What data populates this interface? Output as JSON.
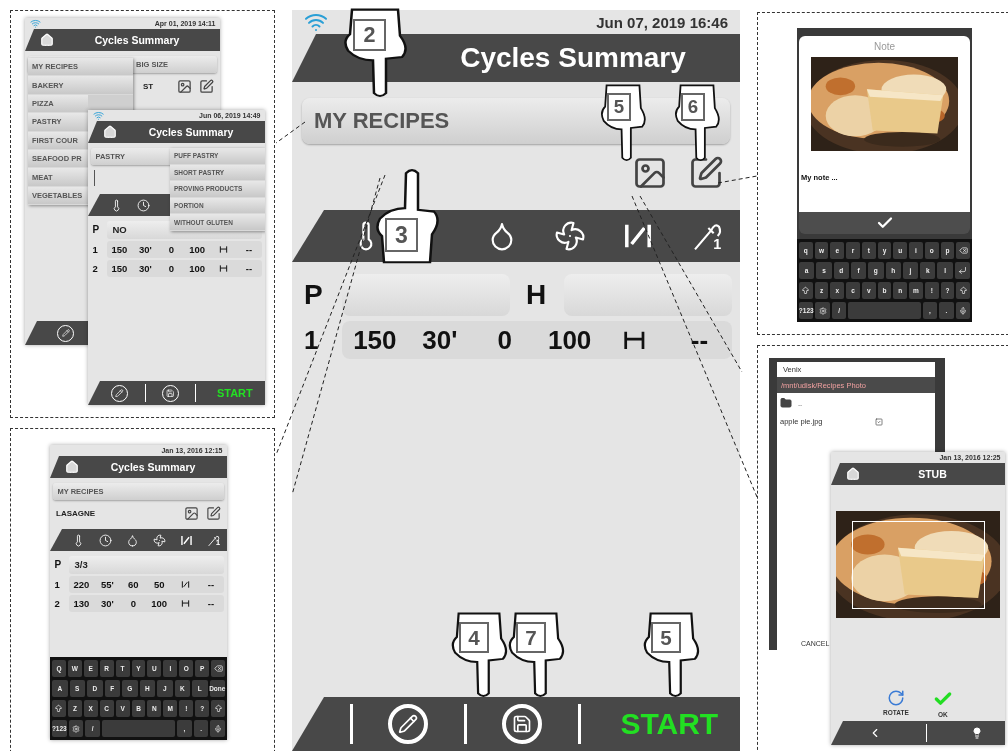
{
  "main_screen": {
    "date": "Jun 07, 2019  16:46",
    "title": "Cycles Summary",
    "category": "MY RECIPES",
    "icons": [
      {
        "kind": "thermometer"
      },
      {
        "kind": "drop"
      },
      {
        "kind": "fan"
      },
      {
        "kind": "valve"
      },
      {
        "kind": "probe",
        "label": "1"
      }
    ],
    "p_label": "P",
    "h_label": "H",
    "steps": [
      {
        "number": "1",
        "temp": "150",
        "time": "30'",
        "humidity": "0",
        "fan": "100",
        "valve_open": false,
        "probe": "--"
      }
    ],
    "action": "START"
  },
  "callouts": [
    {
      "number": "2",
      "points_up": false
    },
    {
      "number": "3",
      "points_up": true
    },
    {
      "number": "5",
      "points_up": false
    },
    {
      "number": "6",
      "points_up": false
    },
    {
      "number": "4",
      "points_up": false
    },
    {
      "number": "7",
      "points_up": false
    },
    {
      "number": "5",
      "points_up": false
    }
  ],
  "recipe_menu_screen": {
    "date": "Apr 01, 2019  14:11",
    "title": "Cycles Summary",
    "field": "BIG SIZE",
    "name": "ST",
    "menu": [
      "MY RECIPES",
      "BAKERY",
      "PIZZA",
      "PASTRY",
      "FIRST COUR",
      "SEAFOOD PR",
      "MEAT",
      "VEGETABLES"
    ]
  },
  "subcategory_screen": {
    "date": "Jun 06, 2019  14:49",
    "title": "Cycles Summary",
    "category": "PASTRY",
    "submenu": [
      "PUFF PASTRY",
      "SHORT PASTRY",
      "PROVING PRODUCTS",
      "PORTION",
      "WITHOUT GLUTEN"
    ],
    "icons": [
      {
        "kind": "thermometer"
      },
      {
        "kind": "clock"
      }
    ],
    "p_label": "P",
    "p_value": "NO",
    "steps": [
      {
        "number": "1",
        "temp": "150",
        "time": "30'",
        "humidity": "0",
        "fan": "100",
        "valve_open": false,
        "probe": "--"
      },
      {
        "number": "2",
        "temp": "150",
        "time": "30'",
        "humidity": "0",
        "fan": "100",
        "valve_open": false,
        "probe": "--"
      }
    ],
    "action": "START"
  },
  "name_screen": {
    "date": "Jan 13, 2016  12:15",
    "title": "Cycles Summary",
    "category": "MY RECIPES",
    "name": "LASAGNE",
    "icons": [
      {
        "kind": "thermometer"
      },
      {
        "kind": "clock"
      },
      {
        "kind": "drop"
      },
      {
        "kind": "fan"
      },
      {
        "kind": "valve"
      },
      {
        "kind": "probe",
        "label": "1"
      }
    ],
    "p_label": "P",
    "p_value": "3/3",
    "steps": [
      {
        "number": "1",
        "temp": "220",
        "time": "55'",
        "humidity": "60",
        "fan": "50",
        "valve_open": true,
        "probe": "--"
      },
      {
        "number": "2",
        "temp": "130",
        "time": "30'",
        "humidity": "0",
        "fan": "100",
        "valve_open": false,
        "probe": "--"
      }
    ],
    "keyboard": {
      "rows": [
        {
          "keys": [
            "Q",
            "W",
            "E",
            "R",
            "T",
            "Y",
            "U",
            "I",
            "O",
            "P",
            {
              "kind": "backspace"
            }
          ]
        },
        {
          "keys": [
            "A",
            "S",
            "D",
            "F",
            "G",
            "H",
            "J",
            "K",
            "L",
            "Done"
          ]
        },
        {
          "keys": [
            {
              "kind": "shift"
            },
            "Z",
            "X",
            "C",
            "V",
            "B",
            "N",
            "M",
            "!",
            "?",
            {
              "kind": "shift"
            }
          ]
        },
        {
          "keys": [
            "?123",
            {
              "kind": "gear"
            },
            "/",
            {
              "kind": "space"
            },
            ",",
            ".",
            {
              "kind": "mic"
            }
          ]
        }
      ]
    }
  },
  "note_dialog": {
    "title": "Note",
    "note": "My note ...",
    "keyboard": {
      "rows": [
        {
          "keys": [
            "q",
            "w",
            "e",
            "r",
            "t",
            "y",
            "u",
            "i",
            "o",
            "p",
            {
              "kind": "backspace"
            }
          ]
        },
        {
          "keys": [
            "a",
            "s",
            "d",
            "f",
            "g",
            "h",
            "j",
            "k",
            "l",
            {
              "kind": "enter"
            }
          ]
        },
        {
          "keys": [
            {
              "kind": "shift"
            },
            "z",
            "x",
            "c",
            "v",
            "b",
            "n",
            "m",
            "!",
            "?",
            {
              "kind": "shift"
            }
          ]
        },
        {
          "keys": [
            "?123",
            {
              "kind": "gear"
            },
            "/",
            {
              "kind": "space"
            },
            ",",
            ".",
            {
              "kind": "mic"
            }
          ]
        }
      ]
    }
  },
  "file_browser": {
    "title": "Venix",
    "path": "/mnt/udisk/Recipes Photo",
    "parent": "..",
    "file": "apple pie.jpg",
    "checked": true,
    "cancel": "CANCEL"
  },
  "crop_screen": {
    "date": "Jan 13, 2016  12:25",
    "title": "STUB",
    "rotate": "ROTATE",
    "ok": "OK"
  }
}
